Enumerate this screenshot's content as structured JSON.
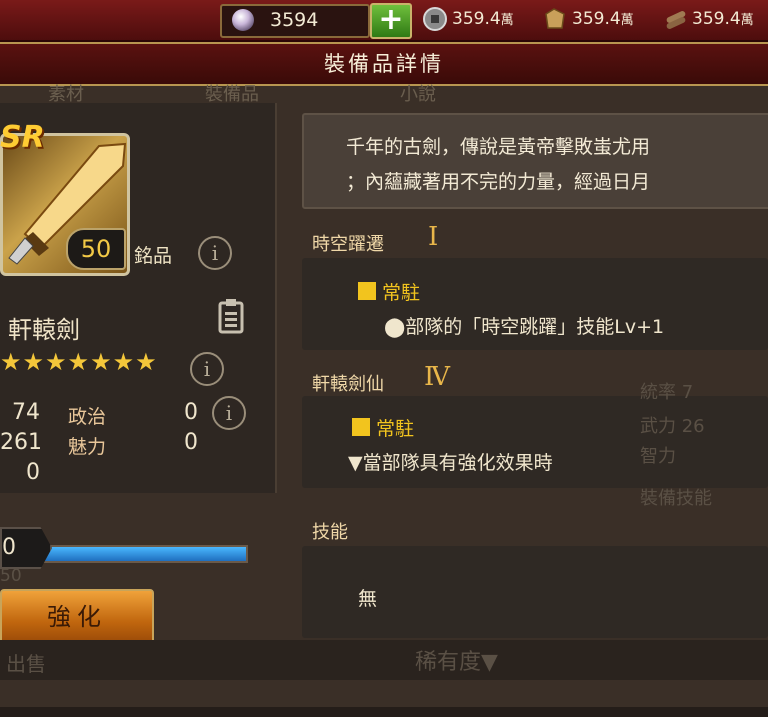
{
  "topbar": {
    "gem_value": "3594",
    "plus_label": "+",
    "resources": [
      {
        "icon": "coin-icon",
        "value": "359.4",
        "unit": "萬"
      },
      {
        "icon": "grain-sack-icon",
        "value": "359.4",
        "unit": "萬"
      },
      {
        "icon": "wood-logs-icon",
        "value": "359.4",
        "unit": "萬"
      }
    ]
  },
  "dialog": {
    "title": "裝備品詳情",
    "ghost_tabs": [
      "素材",
      "裝備品",
      "小說"
    ]
  },
  "item": {
    "rarity": "SR",
    "level": "50",
    "grade": "銘品",
    "name": "軒轅劍",
    "stars": "★★★★★★★",
    "stats": [
      {
        "value": "74",
        "label": "政治",
        "value2": "0"
      },
      {
        "value": "261",
        "label": "魅力",
        "value2": "0"
      },
      {
        "value": "0"
      }
    ],
    "exp_level": "0",
    "exp_fill": 1.0,
    "ghost_level": "50",
    "strengthen_label": "強化"
  },
  "detail": {
    "description": [
      "千年的古劍，傳說是黃帝擊敗蚩尤用",
      "；內蘊藏著用不完的力量，經過日月"
    ],
    "sections": [
      {
        "title": "時空躍遷",
        "rank": "Ⅰ",
        "type": "常駐",
        "effect": "⬤部隊的「時空跳躍」技能Lv+1"
      },
      {
        "title": "軒轅劍仙",
        "rank": "Ⅳ",
        "type": "常駐",
        "effect": "▼當部隊具有強化效果時"
      }
    ],
    "skill_title": "技能",
    "skill_value": "無"
  },
  "bottom": {
    "left_ghost": "出售",
    "center_ghost": "稀有度▼",
    "right_ghost_stats": [
      "統率 7",
      "武力 26",
      "智力"
    ],
    "right_ghost_button": "裝備技能"
  },
  "colors": {
    "accent_gold": "#f2c41e",
    "title_red": "#5a1210",
    "exp_bar": "#2f8fdf"
  }
}
